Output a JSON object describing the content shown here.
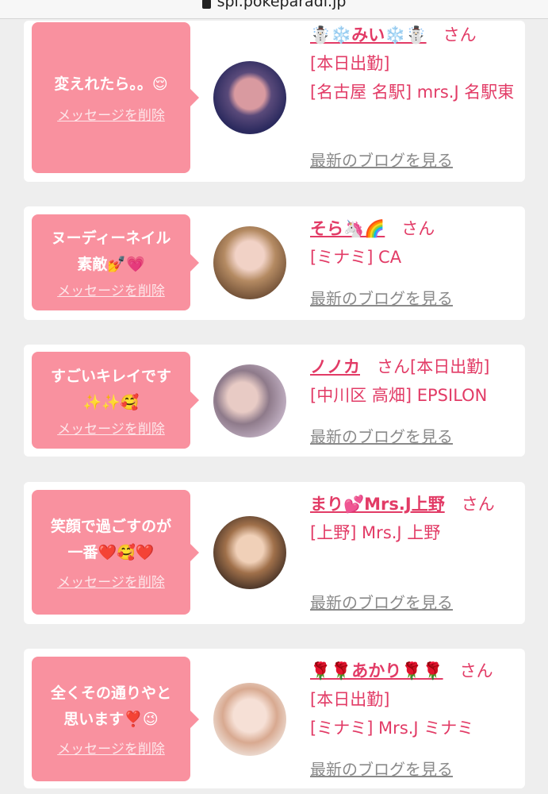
{
  "browser": {
    "url": "spi.pokeparadi.jp"
  },
  "colors": {
    "bubble": "#f9919f",
    "accent": "#e23b66",
    "card": "#ffffff",
    "background": "#eeeeee"
  },
  "cards": [
    {
      "message": "変えれたら。。😌",
      "delete_label": "メッセージを削除",
      "name": "☃️❄️みい❄️☃️",
      "honorific": "さん",
      "status": "[本日出勤]",
      "area_shop": "[名古屋 名駅] mrs.J 名駅東",
      "blog_label": "最新のブログを見る"
    },
    {
      "message": "ヌーディーネイル\n素敵💅💗",
      "delete_label": "メッセージを削除",
      "name": "そら🦄🌈",
      "honorific": "さん",
      "status": "",
      "area_shop": "[ミナミ] CA",
      "blog_label": "最新のブログを見る"
    },
    {
      "message": "すごいキレイです\n✨✨🥰",
      "delete_label": "メッセージを削除",
      "name": "ノノカ",
      "honorific": "さん",
      "status": "[本日出勤]",
      "area_shop": "[中川区 高畑] EPSILON",
      "blog_label": "最新のブログを見る"
    },
    {
      "message": "笑顔で過ごすのが\n一番❤️🥰❤️",
      "delete_label": "メッセージを削除",
      "name": "まり💕Mrs.J上野",
      "honorific": "さん",
      "status": "",
      "area_shop": "[上野] Mrs.J 上野",
      "blog_label": "最新のブログを見る"
    },
    {
      "message": "全くその通りやと\n思います❣️😉",
      "delete_label": "メッセージを削除",
      "name": "🌹🌹あかり🌹🌹",
      "honorific": "さん",
      "status": "[本日出勤]",
      "area_shop": "[ミナミ] Mrs.J ミナミ",
      "blog_label": "最新のブログを見る"
    }
  ]
}
